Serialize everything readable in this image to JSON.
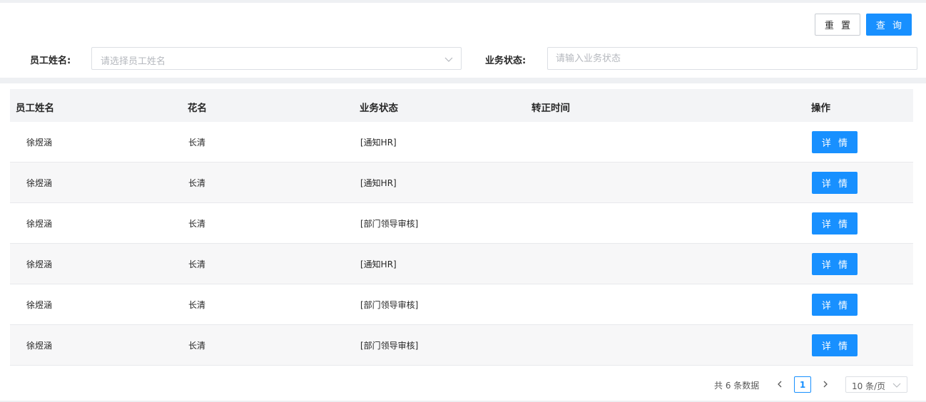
{
  "filters": {
    "reset_label": "重 置",
    "query_label": "查 询",
    "name_label": "员工姓名:",
    "name_placeholder": "请选择员工姓名",
    "status_label": "业务状态:",
    "status_placeholder": "请输入业务状态"
  },
  "table": {
    "headers": {
      "name": "员工姓名",
      "nickname": "花名",
      "status": "业务状态",
      "regular_time": "转正时间",
      "actions": "操作"
    },
    "rows": [
      {
        "name": "徐煜涵",
        "nickname": "长清",
        "status": "[通知HR]",
        "regular_time": "",
        "action": "详 情"
      },
      {
        "name": "徐煜涵",
        "nickname": "长清",
        "status": "[通知HR]",
        "regular_time": "",
        "action": "详 情"
      },
      {
        "name": "徐煜涵",
        "nickname": "长清",
        "status": "[部门领导审核]",
        "regular_time": "",
        "action": "详 情"
      },
      {
        "name": "徐煜涵",
        "nickname": "长清",
        "status": "[通知HR]",
        "regular_time": "",
        "action": "详 情"
      },
      {
        "name": "徐煜涵",
        "nickname": "长清",
        "status": "[部门领导审核]",
        "regular_time": "",
        "action": "详 情"
      },
      {
        "name": "徐煜涵",
        "nickname": "长清",
        "status": "[部门领导审核]",
        "regular_time": "",
        "action": "详 情"
      }
    ]
  },
  "pagination": {
    "total_text": "共 6 条数据",
    "current_page": "1",
    "page_size": "10 条/页"
  },
  "colors": {
    "primary": "#1890ff",
    "header_bg": "#f3f4f6",
    "page_bg": "#eef0f3"
  },
  "icons": {
    "select_arrow": "chevron-down-icon",
    "prev": "chevron-left-icon",
    "next": "chevron-right-icon"
  }
}
